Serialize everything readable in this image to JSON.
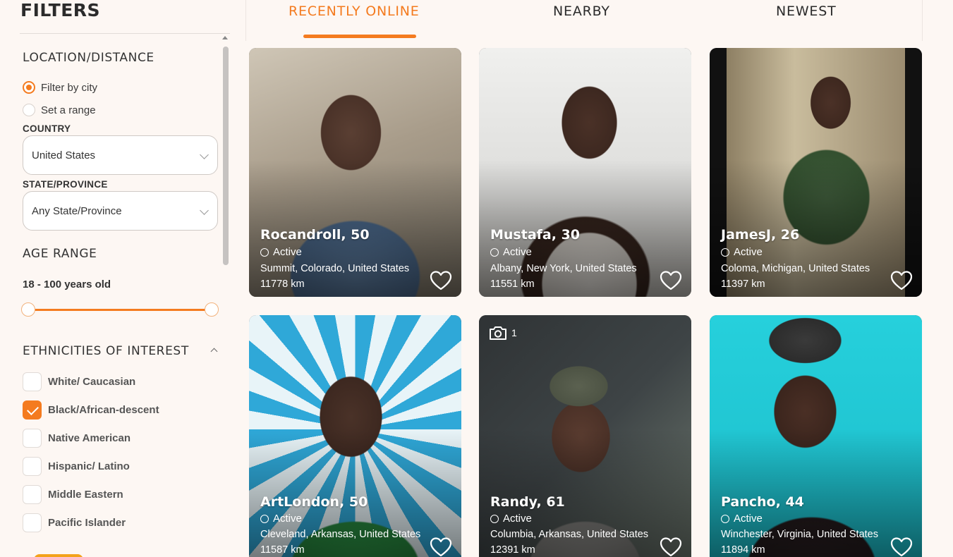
{
  "sidebar": {
    "title": "FILTERS",
    "location": {
      "title": "LOCATION/DISTANCE",
      "options": [
        {
          "label": "Filter by city",
          "selected": true
        },
        {
          "label": "Set a range",
          "selected": false
        }
      ],
      "country_label": "COUNTRY",
      "country_value": "United States",
      "state_label": "STATE/PROVINCE",
      "state_value": "Any State/Province"
    },
    "age": {
      "title": "AGE RANGE",
      "range_text": "18 - 100 years old",
      "min": 18,
      "max": 100
    },
    "ethnicities": {
      "title": "ETHNICITIES OF INTEREST",
      "items": [
        {
          "label": "White/ Caucasian",
          "checked": false
        },
        {
          "label": "Black/African-descent",
          "checked": true
        },
        {
          "label": "Native American",
          "checked": false
        },
        {
          "label": "Hispanic/ Latino",
          "checked": false
        },
        {
          "label": "Middle Eastern",
          "checked": false
        },
        {
          "label": "Pacific Islander",
          "checked": false
        }
      ]
    }
  },
  "tabs": [
    {
      "label": "RECENTLY ONLINE",
      "active": true
    },
    {
      "label": "NEARBY",
      "active": false
    },
    {
      "label": "NEWEST",
      "active": false
    }
  ],
  "profiles": [
    {
      "name": "Rocandroll, 50",
      "status": "Active",
      "location": "Summit, Colorado, United States",
      "distance": "11778 km"
    },
    {
      "name": "Mustafa, 30",
      "status": "Active",
      "location": "Albany, New York, United States",
      "distance": "11551 km"
    },
    {
      "name": "JamesJ, 26",
      "status": "Active",
      "location": "Coloma, Michigan, United States",
      "distance": "11397 km"
    },
    {
      "name": "ArtLondon, 50",
      "status": "Active",
      "location": "Cleveland, Arkansas, United States",
      "distance": "11587 km"
    },
    {
      "name": "Randy, 61",
      "status": "Active",
      "location": "Columbia, Arkansas, United States",
      "distance": "12391 km",
      "photo_count": "1"
    },
    {
      "name": "Pancho, 44",
      "status": "Active",
      "location": "Winchester, Virginia, United States",
      "distance": "11894 km"
    }
  ],
  "colors": {
    "accent": "#f47b1f",
    "background": "#fdf7f3"
  },
  "icons": {
    "favorite": "heart-outline-icon",
    "status": "circle-outline-icon",
    "photos": "camera-icon"
  }
}
